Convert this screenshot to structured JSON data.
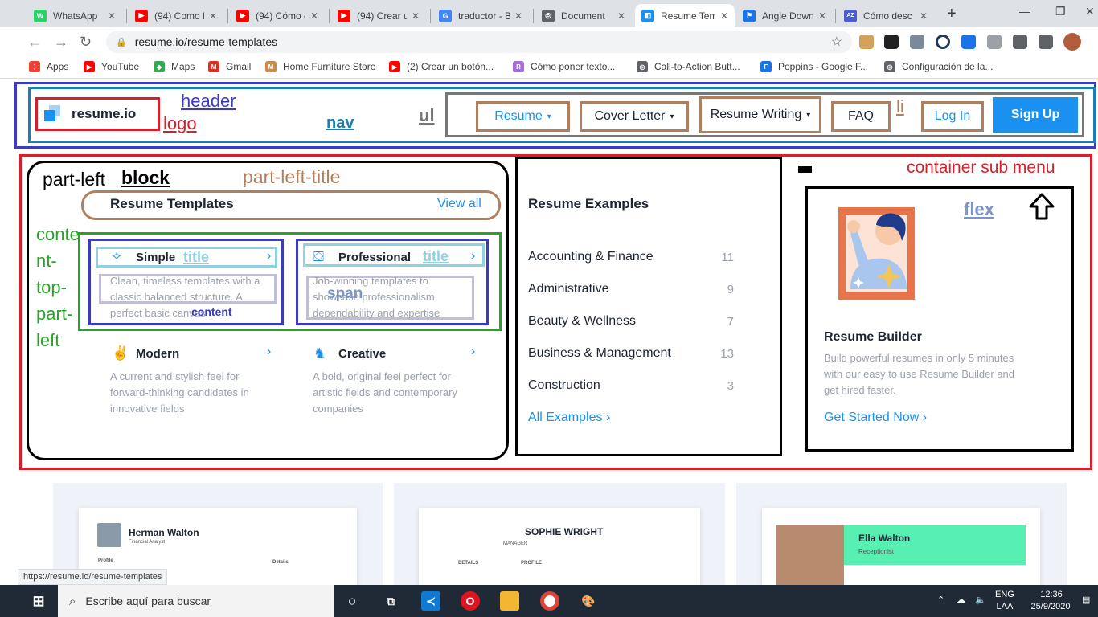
{
  "browser": {
    "tabs": [
      {
        "label": "WhatsApp",
        "color": "#25d366",
        "glyph": "W"
      },
      {
        "label": "(94) Como ho",
        "color": "#ff0000",
        "glyph": "▶"
      },
      {
        "label": "(94) Cómo cr",
        "color": "#ff0000",
        "glyph": "▶"
      },
      {
        "label": "(94) Crear un",
        "color": "#ff0000",
        "glyph": "▶"
      },
      {
        "label": "traductor - B",
        "color": "#4285f4",
        "glyph": "G"
      },
      {
        "label": "Document",
        "color": "#5f6368",
        "glyph": "◎"
      },
      {
        "label": "Resume Tem",
        "color": "#1a91f0",
        "glyph": "◧"
      },
      {
        "label": "Angle Down",
        "color": "#1a73e8",
        "glyph": "⚑"
      },
      {
        "label": "Cómo desc",
        "color": "#4a5ccf",
        "glyph": "AZ"
      }
    ],
    "close_glyph": "✕",
    "new_tab_glyph": "+",
    "url": "resume.io/resume-templates",
    "bookmarks": [
      {
        "label": "Apps",
        "color": "#ea4335",
        "glyph": "⋮"
      },
      {
        "label": "YouTube",
        "color": "#ff0000",
        "glyph": "▶"
      },
      {
        "label": "Maps",
        "color": "#34a853",
        "glyph": "◆"
      },
      {
        "label": "Gmail",
        "color": "#d93025",
        "glyph": "M"
      },
      {
        "label": "Home Furniture Store",
        "color": "#c98b4d",
        "glyph": "M"
      },
      {
        "label": "(2) Crear un botón...",
        "color": "#ff0000",
        "glyph": "▶"
      },
      {
        "label": "Cómo poner texto...",
        "color": "#a36ed8",
        "glyph": "R"
      },
      {
        "label": "Call-to-Action Butt...",
        "color": "#5f6368",
        "glyph": "◎"
      },
      {
        "label": "Poppins - Google F...",
        "color": "#1a73e8",
        "glyph": "F"
      },
      {
        "label": "Configuración de la...",
        "color": "#5f6368",
        "glyph": "◎"
      }
    ],
    "status_url": "https://resume.io/resume-templates"
  },
  "site": {
    "logo_text": "resume.io",
    "nav": {
      "resume": "Resume",
      "cover_letter": "Cover Letter",
      "resume_writing": "Resume Writing",
      "faq": "FAQ",
      "login": "Log In",
      "signup": "Sign Up"
    },
    "templates": {
      "heading": "Resume Templates",
      "view_all": "View all",
      "cards": [
        {
          "title": "Simple",
          "desc": "Clean, timeless templates with a classic balanced structure. A perfect basic canvas"
        },
        {
          "title": "Professional",
          "desc": "Job-winning templates to showcase professionalism, dependability and expertise"
        },
        {
          "title": "Modern",
          "desc": "A current and stylish feel for forward-thinking candidates in innovative fields"
        },
        {
          "title": "Creative",
          "desc": "A bold, original feel perfect for artistic fields and contemporary companies"
        }
      ]
    },
    "examples": {
      "heading": "Resume Examples",
      "items": [
        {
          "label": "Accounting & Finance",
          "count": "11"
        },
        {
          "label": "Administrative",
          "count": "9"
        },
        {
          "label": "Beauty & Wellness",
          "count": "7"
        },
        {
          "label": "Business & Management",
          "count": "13"
        },
        {
          "label": "Construction",
          "count": "3"
        }
      ],
      "all": "All Examples"
    },
    "builder": {
      "title": "Resume Builder",
      "desc": "Build powerful resumes in only 5 minutes with our easy to use Resume Builder and get hired faster.",
      "cta": "Get Started Now"
    },
    "previews": [
      {
        "name": "Herman Walton",
        "role": "Financial Analyst",
        "section": "Profile",
        "details": "Details"
      },
      {
        "name": "SOPHIE WRIGHT",
        "role": "MANAGER",
        "section": "PROFILE",
        "details": "DETAILS"
      },
      {
        "name": "Ella Walton",
        "role": "Receptionist"
      }
    ]
  },
  "annotations": {
    "header": "header",
    "logo": "logo",
    "nav": "nav",
    "ul": "ul",
    "li": "li",
    "part_left": "part-left",
    "block": "block",
    "part_left_title": "part-left-title",
    "content_top_part_left": "conte\nnt-\ntop-\npart-\nleft",
    "title": "title",
    "content": "content",
    "span": "span",
    "container_sub_menu": "container sub menu",
    "flex": "flex"
  },
  "taskbar": {
    "search_placeholder": "Escribe aquí para buscar",
    "lang": "ENG\nLAA",
    "time": "12:36",
    "date": "25/9/2020"
  },
  "colors": {
    "accent": "#1a91f0",
    "ann_red": "#d9202a",
    "ann_blue": "#3b3bc2",
    "ann_brown": "#b07f5d",
    "ann_green": "#2ba32b",
    "ann_lightblue": "#8fd0e4"
  }
}
